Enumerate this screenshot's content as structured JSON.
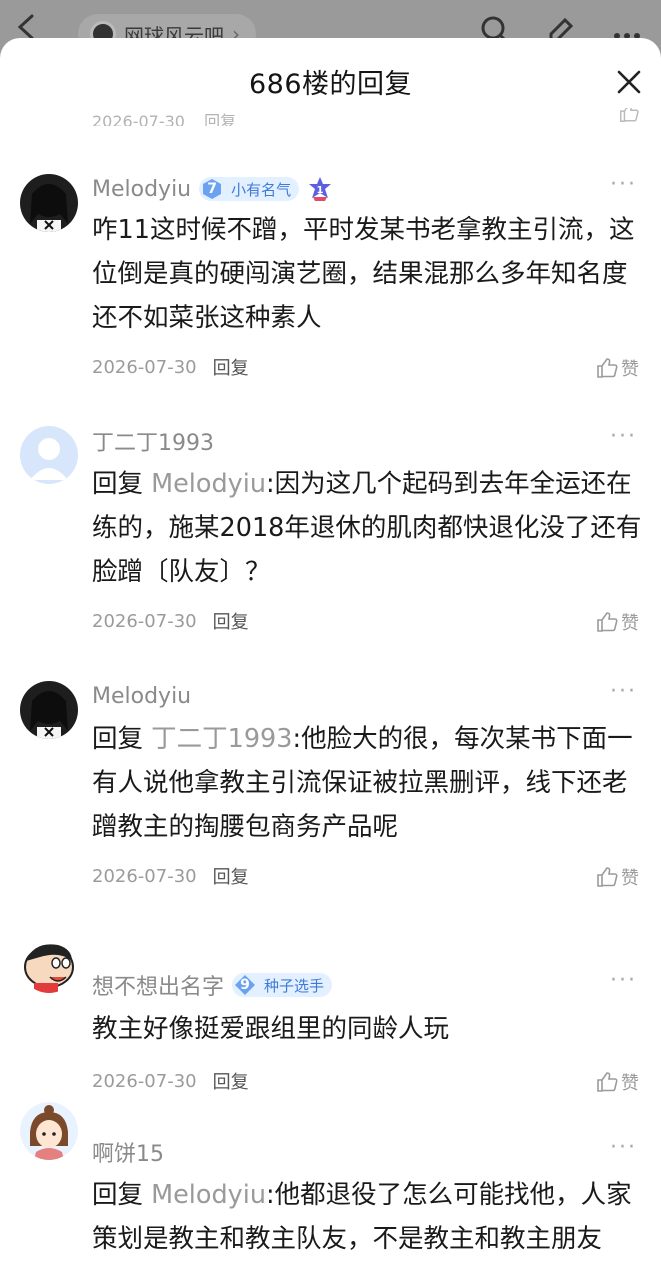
{
  "background": {
    "forum_name": "网球风云吧"
  },
  "sheet": {
    "title": "686楼的回复",
    "cut_date": "2026-07-30",
    "cut_reply": "回复",
    "cut_like": "赞"
  },
  "comments": [
    {
      "username": "Melodyiu",
      "level": "7",
      "level_title": "小有名气",
      "rank": "1",
      "reply_prefix": "",
      "reply_target": "",
      "text": "咋11这时候不蹭，平时发某书老拿教主引流，这位倒是真的硬闯演艺圈，结果混那么多年知名度还不如菜张这种素人",
      "date": "2026-07-30",
      "reply_label": "回复",
      "like_label": "赞"
    },
    {
      "username": "丁二丁1993",
      "reply_prefix": "回复 ",
      "reply_target": "Melodyiu",
      "text": ":因为这几个起码到去年全运还在练的，施某2018年退休的肌肉都快退化没了还有脸蹭〔队友〕？",
      "date": "2026-07-30",
      "reply_label": "回复",
      "like_label": "赞"
    },
    {
      "username": "Melodyiu",
      "reply_prefix": "回复 ",
      "reply_target": "丁二丁1993",
      "text": ":他脸大的很，每次某书下面一有人说他拿教主引流保证被拉黑删评，线下还老蹭教主的掏腰包商务产品呢",
      "date": "2026-07-30",
      "reply_label": "回复",
      "like_label": "赞"
    },
    {
      "username": "想不想出名字",
      "level": "9",
      "level_title": "种子选手",
      "reply_prefix": "",
      "reply_target": "",
      "text": "教主好像挺爱跟组里的同龄人玩",
      "date": "2026-07-30",
      "reply_label": "回复",
      "like_label": "赞"
    },
    {
      "username": "啊饼15",
      "reply_prefix": "回复 ",
      "reply_target": "Melodyiu",
      "text": ":他都退役了怎么可能找他，人家策划是教主和教主队友，不是教主和教主朋友"
    }
  ],
  "more_label": "···"
}
